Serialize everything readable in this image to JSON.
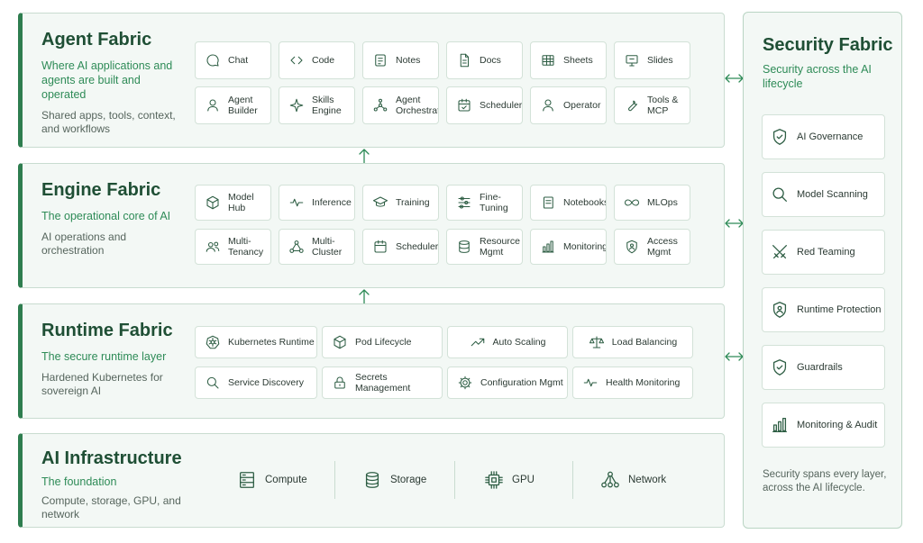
{
  "agent": {
    "title": "Agent Fabric",
    "subtitle": "Where AI applications and agents are built and operated",
    "description": "Shared apps, tools, context, and workflows",
    "row1": [
      {
        "label": "Chat",
        "icon": "chat-icon"
      },
      {
        "label": "Code",
        "icon": "code-icon"
      },
      {
        "label": "Notes",
        "icon": "notes-icon"
      },
      {
        "label": "Docs",
        "icon": "docs-icon"
      },
      {
        "label": "Sheets",
        "icon": "sheets-icon"
      },
      {
        "label": "Slides",
        "icon": "slides-icon"
      }
    ],
    "row2": [
      {
        "label": "Agent Builder",
        "icon": "user-icon"
      },
      {
        "label": "Skills Engine",
        "icon": "sparkle-icon"
      },
      {
        "label": "Agent Orchestrator",
        "icon": "network-icon"
      },
      {
        "label": "Scheduler",
        "icon": "calendar-icon"
      },
      {
        "label": "Operator",
        "icon": "user-icon"
      },
      {
        "label": "Tools & MCP",
        "icon": "wrench-icon"
      }
    ]
  },
  "engine": {
    "title": "Engine Fabric",
    "subtitle": "The operational core of AI",
    "description": "AI operations and orchestration",
    "row1": [
      {
        "label": "Model Hub",
        "icon": "cube-icon"
      },
      {
        "label": "Inference",
        "icon": "pulse-icon"
      },
      {
        "label": "Training",
        "icon": "graduation-cap-icon"
      },
      {
        "label": "Fine-Tuning",
        "icon": "sliders-icon"
      },
      {
        "label": "Notebooks",
        "icon": "notebook-icon"
      },
      {
        "label": "MLOps",
        "icon": "infinity-icon"
      }
    ],
    "row2": [
      {
        "label": "Multi-Tenancy",
        "icon": "users-icon"
      },
      {
        "label": "Multi-Cluster",
        "icon": "cluster-icon"
      },
      {
        "label": "Scheduler",
        "icon": "calendar-icon"
      },
      {
        "label": "Resource Mgmt",
        "icon": "database-icon"
      },
      {
        "label": "Monitoring",
        "icon": "bar-chart-icon"
      },
      {
        "label": "Access Mgmt",
        "icon": "shield-user-icon"
      }
    ]
  },
  "runtime": {
    "title": "Runtime Fabric",
    "subtitle": "The secure runtime layer",
    "description": "Hardened Kubernetes for sovereign AI",
    "row1": [
      {
        "label": "Kubernetes Runtime",
        "icon": "kubernetes-icon"
      },
      {
        "label": "Pod Lifecycle",
        "icon": "cube-icon"
      },
      {
        "label": "Auto Scaling",
        "icon": "trend-up-icon"
      },
      {
        "label": "Load Balancing",
        "icon": "scale-icon"
      }
    ],
    "row2": [
      {
        "label": "Service Discovery",
        "icon": "search-icon"
      },
      {
        "label": "Secrets Management",
        "icon": "lock-icon"
      },
      {
        "label": "Configuration Mgmt",
        "icon": "gear-icon"
      },
      {
        "label": "Health Monitoring",
        "icon": "pulse-icon"
      }
    ]
  },
  "infra": {
    "title": "AI Infrastructure",
    "subtitle": "The foundation",
    "description": "Compute, storage, GPU, and network",
    "items": [
      {
        "label": "Compute",
        "icon": "server-icon"
      },
      {
        "label": "Storage",
        "icon": "database-icon"
      },
      {
        "label": "GPU",
        "icon": "chip-icon"
      },
      {
        "label": "Network",
        "icon": "network-icon"
      }
    ]
  },
  "security": {
    "title": "Security Fabric",
    "subtitle": "Security across the AI lifecycle",
    "items": [
      {
        "label": "AI Governance",
        "icon": "shield-check-icon"
      },
      {
        "label": "Model Scanning",
        "icon": "search-icon"
      },
      {
        "label": "Red Teaming",
        "icon": "crossed-swords-icon"
      },
      {
        "label": "Runtime Protection",
        "icon": "shield-user-icon"
      },
      {
        "label": "Guardrails",
        "icon": "shield-check-icon"
      },
      {
        "label": "Monitoring & Audit",
        "icon": "bar-chart-icon"
      }
    ],
    "footer": "Security spans every layer, across the AI lifecycle."
  },
  "colors": {
    "accent": "#2e7d4f",
    "title": "#1f4f35",
    "subtitle": "#2e8b57",
    "panel": "#f3f8f5"
  }
}
